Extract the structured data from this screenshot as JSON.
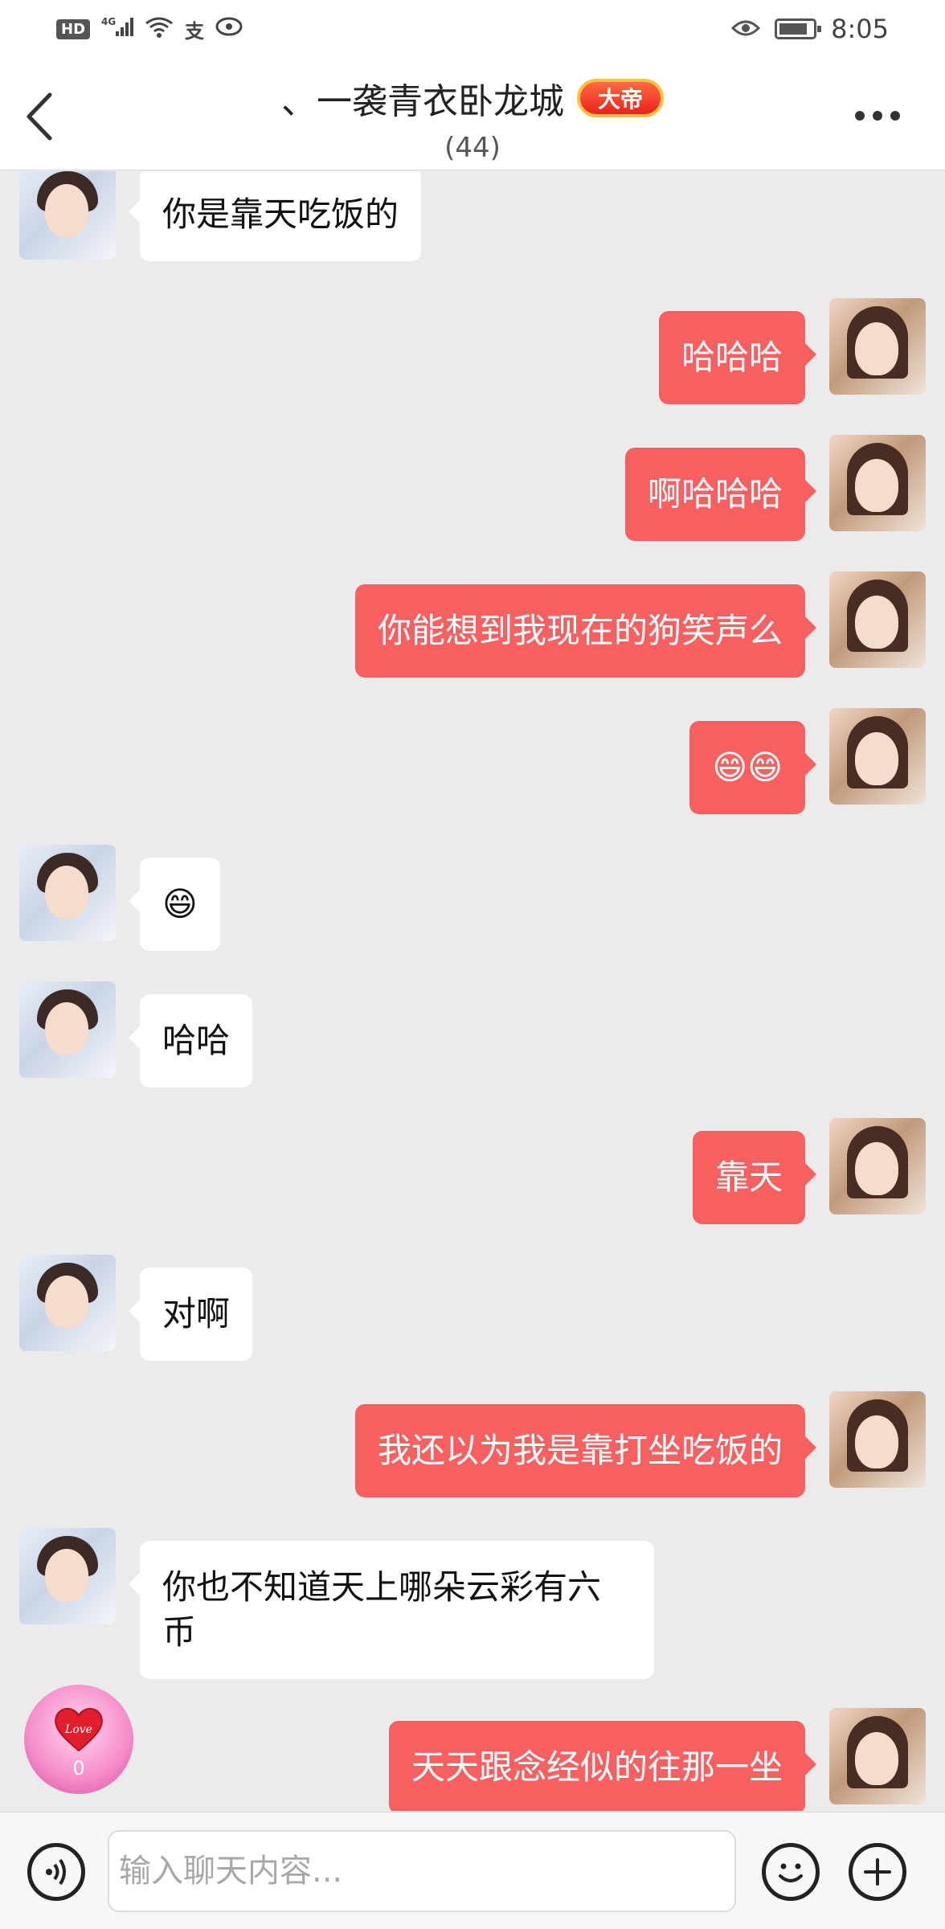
{
  "status_bar": {
    "network_label": "HD",
    "signal_label": "4G",
    "alipay_label": "支",
    "time": "8:05"
  },
  "header": {
    "title": "、一袭青衣卧龙城",
    "badge": "大帝",
    "member_count": "(44)"
  },
  "messages": [
    {
      "side": "left",
      "text": "你是靠天吃饭的"
    },
    {
      "side": "right",
      "text": "哈哈哈"
    },
    {
      "side": "right",
      "text": "啊哈哈哈"
    },
    {
      "side": "right",
      "text": "你能想到我现在的狗笑声么"
    },
    {
      "side": "right",
      "text": "😄😄"
    },
    {
      "side": "left",
      "text": "😄"
    },
    {
      "side": "left",
      "text": "哈哈"
    },
    {
      "side": "right",
      "text": "靠天"
    },
    {
      "side": "left",
      "text": "对啊"
    },
    {
      "side": "right",
      "text": "我还以为我是靠打坐吃饭的"
    },
    {
      "side": "left",
      "text": "你也不知道天上哪朵云彩有六\n币"
    },
    {
      "side": "right",
      "text": "天天跟念经似的往那一坐"
    }
  ],
  "love_button": {
    "label": "Love",
    "count": "0"
  },
  "input_bar": {
    "placeholder": "输入聊天内容..."
  },
  "colors": {
    "outgoing_bubble": "#f76060",
    "incoming_bubble": "#ffffff",
    "background": "#ebebeb"
  },
  "icons": [
    "back-arrow-icon",
    "more-dots-icon",
    "voice-icon",
    "emoji-icon",
    "plus-icon",
    "heart-icon",
    "eye-icon",
    "battery-icon",
    "wifi-icon",
    "signal-icon"
  ]
}
